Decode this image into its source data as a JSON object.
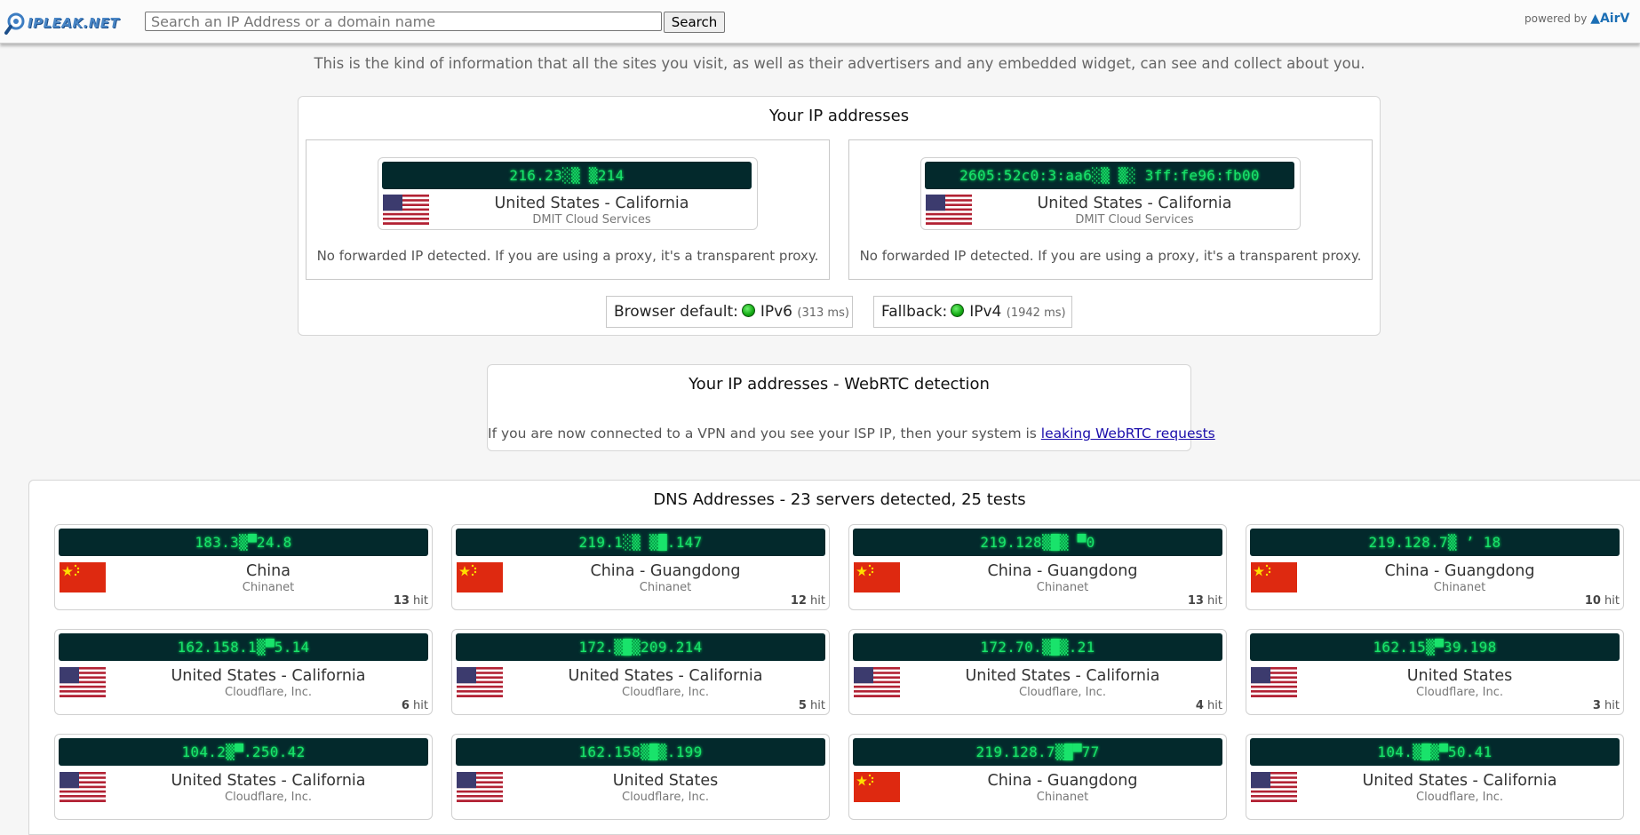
{
  "header": {
    "logo_text": "IPLEAK.NET",
    "search_placeholder": "Search an IP Address or a domain name",
    "search_button": "Search",
    "powered_by": "powered by",
    "powered_brand": "AirV"
  },
  "intro": "This is the kind of information that all the sites you visit, as well as their advertisers and any embedded widget, can see and collect about you.",
  "ip_panel": {
    "title": "Your IP addresses",
    "addresses": [
      {
        "ip": "216.23░▒ ▒214",
        "country": "us",
        "location": "United States - California",
        "isp": "DMIT Cloud Services",
        "note": "No forwarded IP detected. If you are using a proxy, it's a transparent proxy."
      },
      {
        "ip": "2605:52c0:3:aa6░▒ ▒░ 3ff:fe96:fb00",
        "country": "us",
        "location": "United States - California",
        "isp": "DMIT Cloud Services",
        "note": "No forwarded IP detected. If you are using a proxy, it's a transparent proxy."
      }
    ],
    "browser_default_label": "Browser default:",
    "browser_default_value": "IPv6",
    "browser_default_ms": "(313 ms)",
    "fallback_label": "Fallback:",
    "fallback_value": "IPv4",
    "fallback_ms": "(1942 ms)"
  },
  "webrtc": {
    "title": "Your IP addresses - WebRTC detection",
    "text": "If you are now connected to a VPN and you see your ISP IP, then your system is",
    "link": "leaking WebRTC requests"
  },
  "dns": {
    "title": "DNS Addresses - 23 servers detected, 25 tests",
    "hit_label": "hit",
    "servers": [
      {
        "ip": "183.3▒▀24.8",
        "country": "cn",
        "location": "China",
        "isp": "Chinanet",
        "hits": "13"
      },
      {
        "ip": "219.1░▒ ▒█.147",
        "country": "cn",
        "location": "China - Guangdong",
        "isp": "Chinanet",
        "hits": "12"
      },
      {
        "ip": "219.128▒█▒ ▀0",
        "country": "cn",
        "location": "China - Guangdong",
        "isp": "Chinanet",
        "hits": "13"
      },
      {
        "ip": "219.128.7▒ ’ 18",
        "country": "cn",
        "location": "China - Guangdong",
        "isp": "Chinanet",
        "hits": "10"
      },
      {
        "ip": "162.158.1▒▀5.14",
        "country": "us",
        "location": "United States - California",
        "isp": "Cloudflare, Inc.",
        "hits": "6"
      },
      {
        "ip": "172.▒█▒209.214",
        "country": "us",
        "location": "United States - California",
        "isp": "Cloudflare, Inc.",
        "hits": "5"
      },
      {
        "ip": "172.70.▒█▒.21",
        "country": "us",
        "location": "United States - California",
        "isp": "Cloudflare, Inc.",
        "hits": "4"
      },
      {
        "ip": "162.15▒▀39.198",
        "country": "us",
        "location": "United States",
        "isp": "Cloudflare, Inc.",
        "hits": "3"
      },
      {
        "ip": "104.2▒▀.250.42",
        "country": "us",
        "location": "United States - California",
        "isp": "Cloudflare, Inc.",
        "hits": ""
      },
      {
        "ip": "162.158▒█▒.199",
        "country": "us",
        "location": "United States",
        "isp": "Cloudflare, Inc.",
        "hits": ""
      },
      {
        "ip": "219.128.7▒█▀77",
        "country": "cn",
        "location": "China - Guangdong",
        "isp": "Chinanet",
        "hits": ""
      },
      {
        "ip": "104.▒█▒▀50.41",
        "country": "us",
        "location": "United States - California",
        "isp": "Cloudflare, Inc.",
        "hits": ""
      }
    ]
  }
}
